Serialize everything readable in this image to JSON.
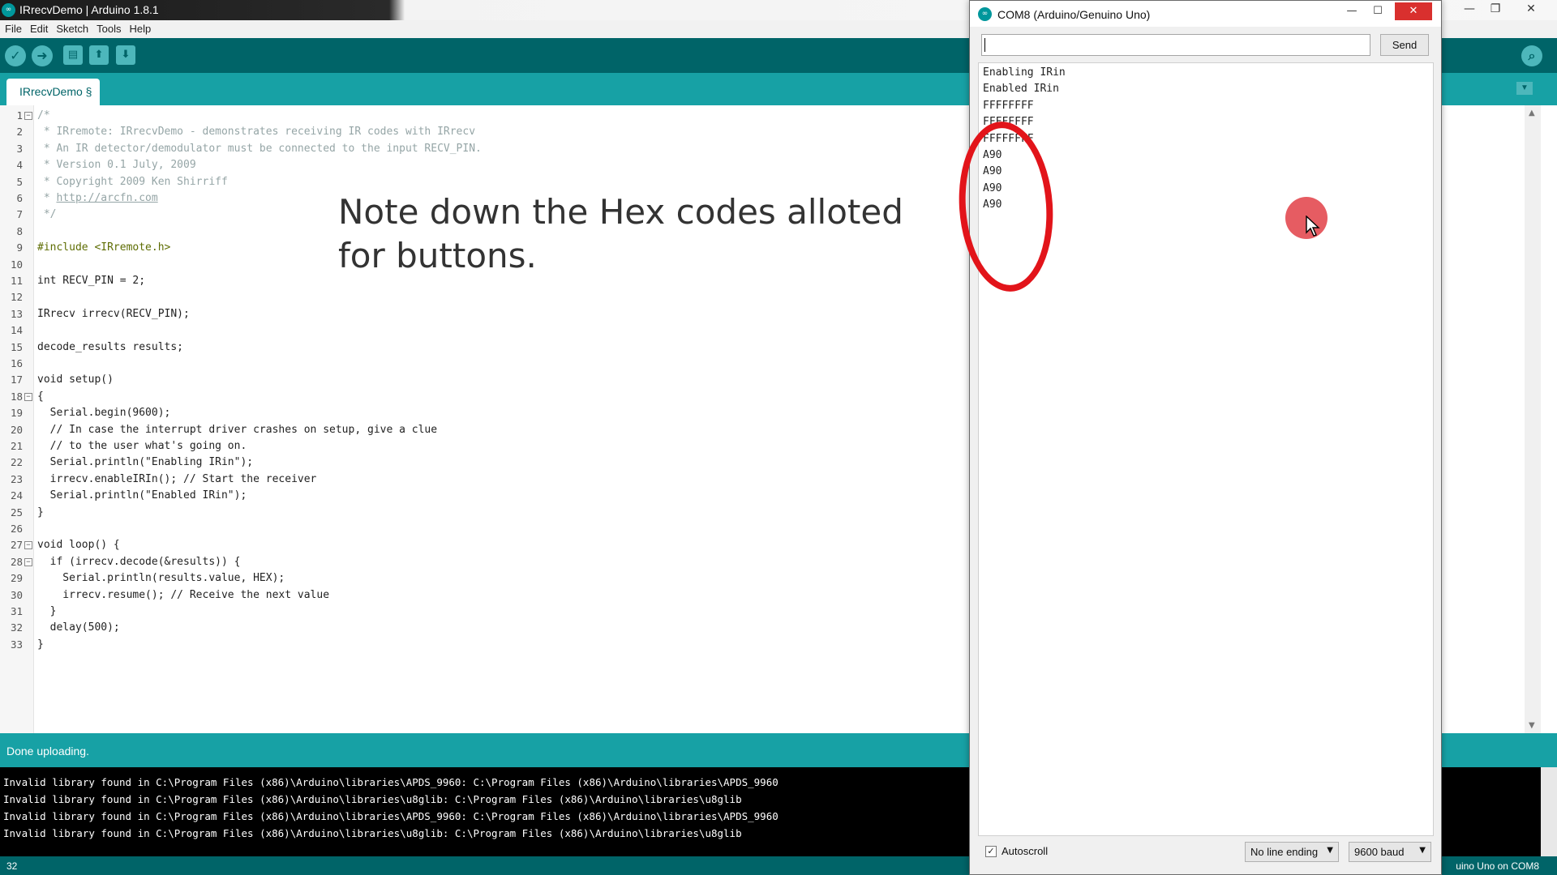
{
  "ide": {
    "title": "IRrecvDemo | Arduino 1.8.1",
    "menu": [
      "File",
      "Edit",
      "Sketch",
      "Tools",
      "Help"
    ],
    "toolbar": {
      "verify_icon": "check-icon",
      "upload_icon": "arrow-right-icon",
      "new_icon": "new-file-icon",
      "open_icon": "open-arrow-up-icon",
      "save_icon": "save-arrow-down-icon",
      "serial_monitor_icon": "magnifier-icon"
    },
    "tab_label": "IRrecvDemo §",
    "code_lines": [
      {
        "n": "1",
        "text": "/*"
      },
      {
        "n": "2",
        "text": " * IRremote: IRrecvDemo - demonstrates receiving IR codes with IRrecv"
      },
      {
        "n": "3",
        "text": " * An IR detector/demodulator must be connected to the input RECV_PIN."
      },
      {
        "n": "4",
        "text": " * Version 0.1 July, 2009"
      },
      {
        "n": "5",
        "text": " * Copyright 2009 Ken Shirriff"
      },
      {
        "n": "6",
        "text": "http://arcfn.com"
      },
      {
        "n": "7",
        "text": " */"
      },
      {
        "n": "8",
        "text": ""
      },
      {
        "n": "9",
        "text": "#include <IRremote.h>"
      },
      {
        "n": "10",
        "text": ""
      },
      {
        "n": "11",
        "text": "int RECV_PIN = 2;"
      },
      {
        "n": "12",
        "text": ""
      },
      {
        "n": "13",
        "text": "IRrecv irrecv(RECV_PIN);"
      },
      {
        "n": "14",
        "text": ""
      },
      {
        "n": "15",
        "text": "decode_results results;"
      },
      {
        "n": "16",
        "text": ""
      },
      {
        "n": "17",
        "text": "void setup()"
      },
      {
        "n": "18",
        "text": "{"
      },
      {
        "n": "19",
        "text": "  Serial.begin(9600);"
      },
      {
        "n": "20",
        "text": "  // In case the interrupt driver crashes on setup, give a clue"
      },
      {
        "n": "21",
        "text": "  // to the user what's going on."
      },
      {
        "n": "22",
        "text": "  Serial.println(\"Enabling IRin\");"
      },
      {
        "n": "23",
        "text": "  irrecv.enableIRIn(); // Start the receiver"
      },
      {
        "n": "24",
        "text": "  Serial.println(\"Enabled IRin\");"
      },
      {
        "n": "25",
        "text": "}"
      },
      {
        "n": "26",
        "text": ""
      },
      {
        "n": "27",
        "text": "void loop() {"
      },
      {
        "n": "28",
        "text": "  if (irrecv.decode(&results)) {"
      },
      {
        "n": "29",
        "text": "    Serial.println(results.value, HEX);"
      },
      {
        "n": "30",
        "text": "    irrecv.resume(); // Receive the next value"
      },
      {
        "n": "31",
        "text": "  }"
      },
      {
        "n": "32",
        "text": "  delay(500);"
      },
      {
        "n": "33",
        "text": "}"
      }
    ],
    "overlay_note": "Note down the Hex codes alloted for buttons.",
    "status": "Done uploading.",
    "console_lines": [
      "Invalid library found in C:\\Program Files (x86)\\Arduino\\libraries\\APDS_9960: C:\\Program Files (x86)\\Arduino\\libraries\\APDS_9960",
      "Invalid library found in C:\\Program Files (x86)\\Arduino\\libraries\\u8glib: C:\\Program Files (x86)\\Arduino\\libraries\\u8glib",
      "Invalid library found in C:\\Program Files (x86)\\Arduino\\libraries\\APDS_9960: C:\\Program Files (x86)\\Arduino\\libraries\\APDS_9960",
      "Invalid library found in C:\\Program Files (x86)\\Arduino\\libraries\\u8glib: C:\\Program Files (x86)\\Arduino\\libraries\\u8glib"
    ],
    "line_number": "32",
    "board": "uino Uno on COM8"
  },
  "serial": {
    "title": "COM8 (Arduino/Genuino Uno)",
    "input_value": "",
    "send_label": "Send",
    "output_lines": [
      "Enabling IRin",
      "Enabled IRin",
      "FFFFFFFF",
      "FFFFFFFF",
      "FFFFFFFF",
      "A90",
      "A90",
      "A90",
      "A90"
    ],
    "autoscroll_label": "Autoscroll",
    "autoscroll_checked": true,
    "line_ending": "No line ending",
    "baud": "9600 baud"
  },
  "colors": {
    "toolbar": "#006468",
    "tabbar": "#17a1a5",
    "annotation": "#e2141a"
  }
}
